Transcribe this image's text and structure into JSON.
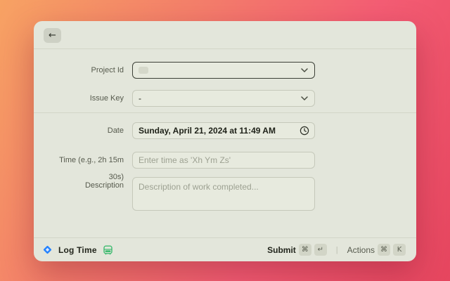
{
  "header": {
    "back_icon": "←"
  },
  "form": {
    "project": {
      "label": "Project Id"
    },
    "issue": {
      "label": "Issue Key",
      "value": "-"
    },
    "date": {
      "label": "Date",
      "value": "Sunday, April 21, 2024 at 11:49 AM"
    },
    "time": {
      "label": "Time (e.g., 2h 15m 30s)",
      "placeholder": "Enter time as 'Xh Ym Zs'"
    },
    "description": {
      "label": "Description",
      "placeholder": "Description of work completed..."
    }
  },
  "footer": {
    "title": "Log Time",
    "submit": {
      "label": "Submit",
      "keys": [
        "⌘",
        "↵"
      ]
    },
    "actions": {
      "label": "Actions",
      "keys": [
        "⌘",
        "K"
      ]
    },
    "separator": "|"
  },
  "colors": {
    "accent_blue": "#2684FF",
    "icon_green": "#3DBA6F",
    "window_bg": "#E3E6DB",
    "gradient_start": "#F7A263",
    "gradient_end": "#E6465F"
  }
}
